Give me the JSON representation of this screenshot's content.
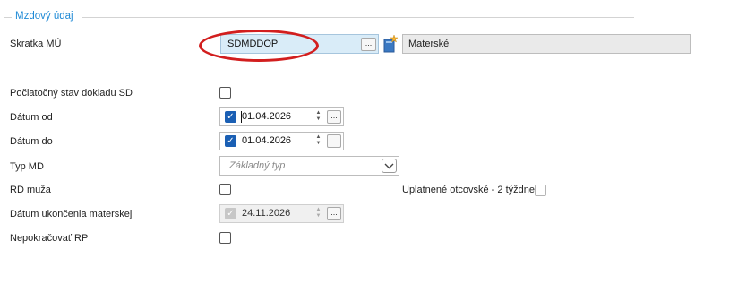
{
  "section": {
    "title": "Mzdový údaj"
  },
  "fields": {
    "skratka": {
      "label": "Skratka MÚ",
      "value": "SDMDDOP",
      "button": "...",
      "description": "Materské"
    },
    "pociatocny": {
      "label": "Počiatočný stav dokladu SD",
      "checked": false
    },
    "datum_od": {
      "label": "Dátum od",
      "value": "01.04.2026",
      "enabled": true,
      "button": "..."
    },
    "datum_do": {
      "label": "Dátum do",
      "value": "01.04.2026",
      "enabled": true,
      "button": "..."
    },
    "typ_md": {
      "label": "Typ MD",
      "placeholder": "Základný typ"
    },
    "rd_muza": {
      "label": "RD muža",
      "checked": false
    },
    "otcovske": {
      "label": "Uplatnené otcovské - 2 týždne",
      "checked": false
    },
    "datum_ukoncenia": {
      "label": "Dátum ukončenia materskej",
      "value": "24.11.2026",
      "enabled": false,
      "button": "..."
    },
    "nepokracovat": {
      "label": "Nepokračovať RP",
      "checked": false
    }
  },
  "icons": {
    "star": "star-icon",
    "dropdown": "chevron-down-icon",
    "checkmark": "checkmark-icon"
  },
  "colors": {
    "section_title": "#1f8ad6",
    "lookup_background": "#d9ecf8",
    "checkbox_checked": "#1a5fb4",
    "highlight_ellipse": "#d21e1e"
  }
}
